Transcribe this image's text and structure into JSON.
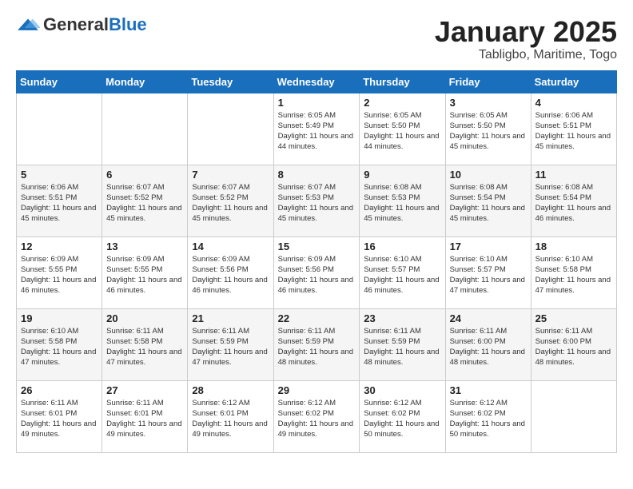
{
  "logo": {
    "general": "General",
    "blue": "Blue"
  },
  "title": "January 2025",
  "location": "Tabligbo, Maritime, Togo",
  "weekdays": [
    "Sunday",
    "Monday",
    "Tuesday",
    "Wednesday",
    "Thursday",
    "Friday",
    "Saturday"
  ],
  "weeks": [
    [
      {
        "day": "",
        "info": ""
      },
      {
        "day": "",
        "info": ""
      },
      {
        "day": "",
        "info": ""
      },
      {
        "day": "1",
        "info": "Sunrise: 6:05 AM\nSunset: 5:49 PM\nDaylight: 11 hours and 44 minutes."
      },
      {
        "day": "2",
        "info": "Sunrise: 6:05 AM\nSunset: 5:50 PM\nDaylight: 11 hours and 44 minutes."
      },
      {
        "day": "3",
        "info": "Sunrise: 6:05 AM\nSunset: 5:50 PM\nDaylight: 11 hours and 45 minutes."
      },
      {
        "day": "4",
        "info": "Sunrise: 6:06 AM\nSunset: 5:51 PM\nDaylight: 11 hours and 45 minutes."
      }
    ],
    [
      {
        "day": "5",
        "info": "Sunrise: 6:06 AM\nSunset: 5:51 PM\nDaylight: 11 hours and 45 minutes."
      },
      {
        "day": "6",
        "info": "Sunrise: 6:07 AM\nSunset: 5:52 PM\nDaylight: 11 hours and 45 minutes."
      },
      {
        "day": "7",
        "info": "Sunrise: 6:07 AM\nSunset: 5:52 PM\nDaylight: 11 hours and 45 minutes."
      },
      {
        "day": "8",
        "info": "Sunrise: 6:07 AM\nSunset: 5:53 PM\nDaylight: 11 hours and 45 minutes."
      },
      {
        "day": "9",
        "info": "Sunrise: 6:08 AM\nSunset: 5:53 PM\nDaylight: 11 hours and 45 minutes."
      },
      {
        "day": "10",
        "info": "Sunrise: 6:08 AM\nSunset: 5:54 PM\nDaylight: 11 hours and 45 minutes."
      },
      {
        "day": "11",
        "info": "Sunrise: 6:08 AM\nSunset: 5:54 PM\nDaylight: 11 hours and 46 minutes."
      }
    ],
    [
      {
        "day": "12",
        "info": "Sunrise: 6:09 AM\nSunset: 5:55 PM\nDaylight: 11 hours and 46 minutes."
      },
      {
        "day": "13",
        "info": "Sunrise: 6:09 AM\nSunset: 5:55 PM\nDaylight: 11 hours and 46 minutes."
      },
      {
        "day": "14",
        "info": "Sunrise: 6:09 AM\nSunset: 5:56 PM\nDaylight: 11 hours and 46 minutes."
      },
      {
        "day": "15",
        "info": "Sunrise: 6:09 AM\nSunset: 5:56 PM\nDaylight: 11 hours and 46 minutes."
      },
      {
        "day": "16",
        "info": "Sunrise: 6:10 AM\nSunset: 5:57 PM\nDaylight: 11 hours and 46 minutes."
      },
      {
        "day": "17",
        "info": "Sunrise: 6:10 AM\nSunset: 5:57 PM\nDaylight: 11 hours and 47 minutes."
      },
      {
        "day": "18",
        "info": "Sunrise: 6:10 AM\nSunset: 5:58 PM\nDaylight: 11 hours and 47 minutes."
      }
    ],
    [
      {
        "day": "19",
        "info": "Sunrise: 6:10 AM\nSunset: 5:58 PM\nDaylight: 11 hours and 47 minutes."
      },
      {
        "day": "20",
        "info": "Sunrise: 6:11 AM\nSunset: 5:58 PM\nDaylight: 11 hours and 47 minutes."
      },
      {
        "day": "21",
        "info": "Sunrise: 6:11 AM\nSunset: 5:59 PM\nDaylight: 11 hours and 47 minutes."
      },
      {
        "day": "22",
        "info": "Sunrise: 6:11 AM\nSunset: 5:59 PM\nDaylight: 11 hours and 48 minutes."
      },
      {
        "day": "23",
        "info": "Sunrise: 6:11 AM\nSunset: 5:59 PM\nDaylight: 11 hours and 48 minutes."
      },
      {
        "day": "24",
        "info": "Sunrise: 6:11 AM\nSunset: 6:00 PM\nDaylight: 11 hours and 48 minutes."
      },
      {
        "day": "25",
        "info": "Sunrise: 6:11 AM\nSunset: 6:00 PM\nDaylight: 11 hours and 48 minutes."
      }
    ],
    [
      {
        "day": "26",
        "info": "Sunrise: 6:11 AM\nSunset: 6:01 PM\nDaylight: 11 hours and 49 minutes."
      },
      {
        "day": "27",
        "info": "Sunrise: 6:11 AM\nSunset: 6:01 PM\nDaylight: 11 hours and 49 minutes."
      },
      {
        "day": "28",
        "info": "Sunrise: 6:12 AM\nSunset: 6:01 PM\nDaylight: 11 hours and 49 minutes."
      },
      {
        "day": "29",
        "info": "Sunrise: 6:12 AM\nSunset: 6:02 PM\nDaylight: 11 hours and 49 minutes."
      },
      {
        "day": "30",
        "info": "Sunrise: 6:12 AM\nSunset: 6:02 PM\nDaylight: 11 hours and 50 minutes."
      },
      {
        "day": "31",
        "info": "Sunrise: 6:12 AM\nSunset: 6:02 PM\nDaylight: 11 hours and 50 minutes."
      },
      {
        "day": "",
        "info": ""
      }
    ]
  ]
}
